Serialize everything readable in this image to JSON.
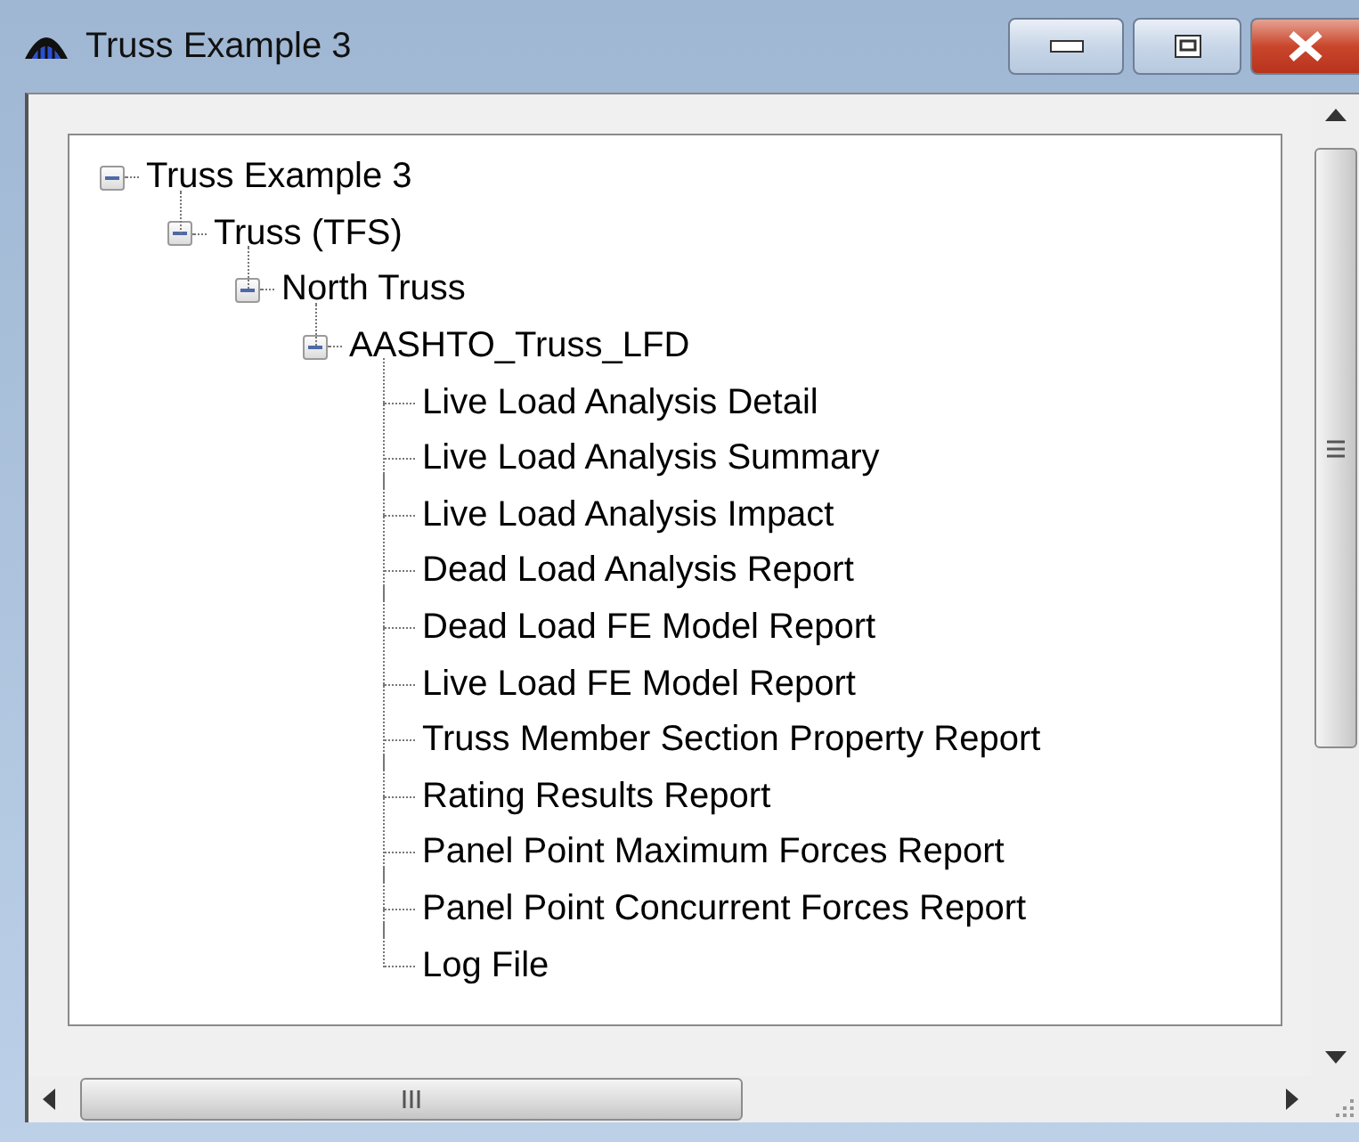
{
  "window": {
    "title": "Truss Example 3"
  },
  "tree": [
    {
      "label": "Truss Example 3",
      "expanded": true,
      "children": [
        {
          "label": "Truss (TFS)",
          "expanded": true,
          "children": [
            {
              "label": "North Truss",
              "expanded": true,
              "children": [
                {
                  "label": "AASHTO_Truss_LFD",
                  "expanded": true,
                  "children": [
                    {
                      "label": "Live Load Analysis Detail"
                    },
                    {
                      "label": "Live Load Analysis Summary"
                    },
                    {
                      "label": "Live Load Analysis Impact"
                    },
                    {
                      "label": "Dead Load Analysis Report"
                    },
                    {
                      "label": "Dead Load FE Model Report"
                    },
                    {
                      "label": "Live Load FE Model Report"
                    },
                    {
                      "label": "Truss Member Section Property Report"
                    },
                    {
                      "label": "Rating Results Report"
                    },
                    {
                      "label": "Panel Point Maximum Forces Report"
                    },
                    {
                      "label": "Panel Point Concurrent Forces Report"
                    },
                    {
                      "label": "Log File"
                    }
                  ]
                }
              ]
            }
          ]
        }
      ]
    }
  ]
}
